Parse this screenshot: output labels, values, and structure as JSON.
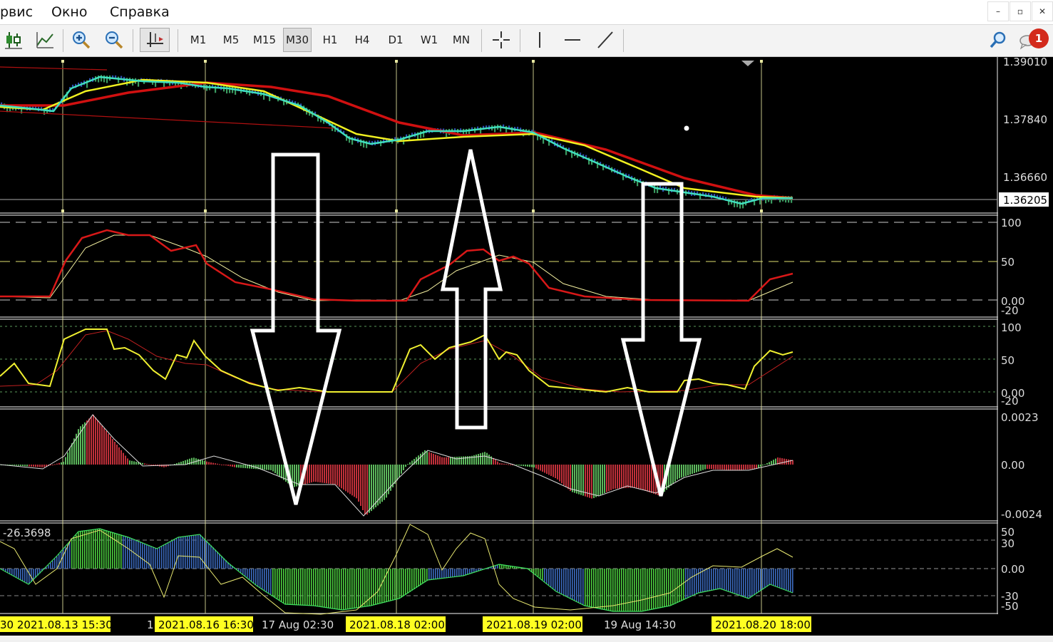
{
  "menu": {
    "service": "рвис",
    "window": "Окно",
    "help": "Справка"
  },
  "window_controls": {
    "minimize": "–",
    "restore": "▫",
    "close": "✕"
  },
  "toolbar": {
    "timeframes": [
      "M1",
      "M5",
      "M15",
      "M30",
      "H1",
      "H4",
      "D1",
      "W1",
      "MN"
    ],
    "active_timeframe": "M30",
    "notification_count": "1",
    "icons": [
      "candlestick-chart-icon",
      "line-chart-icon",
      "zoom-in-icon",
      "zoom-out-icon",
      "chart-shift-icon",
      "crosshair-icon",
      "vertical-line-icon",
      "horizontal-line-icon",
      "trendline-icon",
      "search-icon",
      "chat-icon"
    ]
  },
  "colors": {
    "ma_red": "#d01010",
    "ma_yellow": "#f0f020",
    "ma_cyan": "#40e0c0",
    "hist_green": "#5cb85c",
    "hist_red": "#c0303a",
    "hist_blue": "#3c6cc0",
    "grid": "#777777",
    "highlight_label_bg": "#ffff22"
  },
  "price_axis": {
    "p1": "1.39010",
    "p2": "1.37840",
    "p3": "1.36660",
    "current": "1.36205"
  },
  "stoch1_axis": {
    "top": "100",
    "mid": "50",
    "zero": "0.00",
    "low": "-20"
  },
  "stoch2_axis": {
    "top": "100",
    "mid": "50",
    "zero": "0.00",
    "low": "-20"
  },
  "macd_axis": {
    "top": "0.0023",
    "zero": "0.00",
    "bottom": "-0.0024"
  },
  "cci_panel": {
    "value_label": "-26.3698",
    "a50": "50",
    "a30": "30",
    "zero": "0.00",
    "n30": "-30",
    "n50": "-50"
  },
  "time_axis": {
    "t1": "30 2021.08.13 15:30",
    "t2_prefix": "1",
    "t2": "2021.08.16 16:30",
    "t3": "17 Aug 02:30",
    "t4": "2021.08.18 02:00",
    "t5": "2021.08.19 02:00",
    "t6": "19 Aug 14:30",
    "t7": "2021.08.20 18:00"
  }
}
